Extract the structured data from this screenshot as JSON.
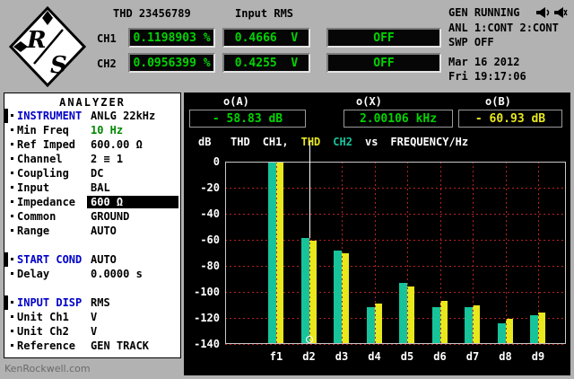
{
  "header": {
    "thd_label": "THD 23456789",
    "input_rms_label": "Input RMS",
    "ch1_label": "CH1",
    "ch2_label": "CH2",
    "ch1_value": "0.1198903 %",
    "ch2_value": "0.0956399 %",
    "rms1_value": "0.4666  V",
    "rms2_value": "0.4255  V",
    "off1": "OFF",
    "off2": "OFF",
    "gen_status": "GEN RUNNING",
    "status_icons": [
      "speaker-icon",
      "speaker-icon"
    ],
    "anl_status": "ANL 1:CONT 2:CONT",
    "swp_status": "SWP OFF",
    "date": "Mar 16 2012",
    "time": "Fri 19:17:06"
  },
  "analyzer_panel": {
    "title": "ANALYZER",
    "rows": [
      {
        "label": "INSTRUMENT",
        "value": "ANLG 22kHz",
        "type": "section"
      },
      {
        "label": "Min Freq",
        "value": "10 Hz",
        "value_color": "green"
      },
      {
        "label": "Ref Imped",
        "value": "600.00 Ω"
      },
      {
        "label": "Channel",
        "value": "2 ≡ 1"
      },
      {
        "label": "Coupling",
        "value": "DC"
      },
      {
        "label": "Input",
        "value": "BAL"
      },
      {
        "label": "Impedance",
        "value": "600 Ω",
        "highlight": true
      },
      {
        "label": "Common",
        "value": "GROUND"
      },
      {
        "label": "Range",
        "value": "AUTO"
      },
      {
        "type": "spacer"
      },
      {
        "label": "START COND",
        "value": "AUTO",
        "type": "section"
      },
      {
        "label": "Delay",
        "value": "0.0000 s"
      },
      {
        "type": "spacer"
      },
      {
        "label": "INPUT DISP",
        "value": "RMS",
        "type": "section"
      },
      {
        "label": "Unit Ch1",
        "value": "V"
      },
      {
        "label": "Unit Ch2",
        "value": "V"
      },
      {
        "label": "Reference",
        "value": "GEN TRACK"
      }
    ]
  },
  "cursors": {
    "a_label": "o(A)",
    "a_value": "- 58.83 dB",
    "x_label": "o(X)",
    "x_value": "2.00106 kHz",
    "b_label": "o(B)",
    "b_value": "- 60.93 dB"
  },
  "chart_data": {
    "type": "bar",
    "categories": [
      "f1",
      "d2",
      "d3",
      "d4",
      "d5",
      "d6",
      "d7",
      "d8",
      "d9"
    ],
    "series": [
      {
        "name": "THD CH1",
        "color": "#17c39b",
        "values": [
          0,
          -58.8,
          -68,
          -112,
          -93,
          -112,
          -112,
          -124,
          -118
        ]
      },
      {
        "name": "THD CH2",
        "color": "#e8e81c",
        "values": [
          0,
          -60.9,
          -70,
          -109,
          -96,
          -107,
          -110,
          -121,
          -116
        ]
      }
    ],
    "ylim": [
      -140,
      0
    ],
    "yticks": [
      0,
      -20,
      -40,
      -60,
      -80,
      -100,
      -120,
      -140
    ],
    "ylabel": "dB",
    "xlabel": "FREQUENCY/Hz",
    "legend_tokens": [
      {
        "text": "THD",
        "color": "#ffffff"
      },
      {
        "text": "CH1,",
        "color": "#ffffff"
      },
      {
        "text": "THD",
        "color": "#e8e81c"
      },
      {
        "text": "CH2",
        "color": "#17c39b"
      },
      {
        "text": "vs",
        "color": "#ffffff"
      },
      {
        "text": "FREQUENCY/Hz",
        "color": "#ffffff"
      }
    ],
    "grid_color": "#bb2222",
    "cursor": {
      "category": "d2",
      "marker": "circle"
    }
  },
  "watermark": "KenRockwell.com"
}
